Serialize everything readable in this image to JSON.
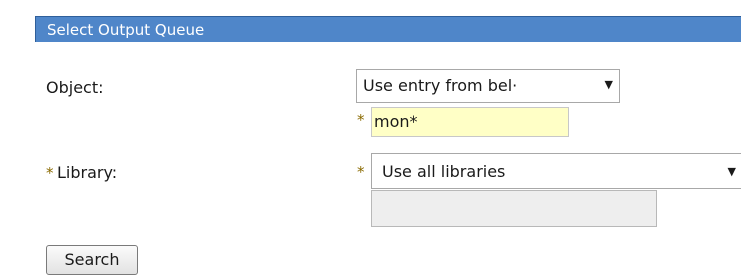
{
  "panel": {
    "title": "Select Output Queue"
  },
  "object": {
    "label": "Object:",
    "select_value": "Use entry from bel·",
    "required_marker": "*",
    "input_value": "mon*"
  },
  "library": {
    "required_marker": "*",
    "label": "Library:",
    "field_required_marker": "*",
    "select_value": "Use all libraries",
    "input_value": ""
  },
  "search_button": {
    "label": "Search"
  },
  "icons": {
    "dropdown_arrow": "▼"
  },
  "colors": {
    "header_bg": "#4f86c9",
    "required": "#8a6a00",
    "input_highlight": "#ffffc6",
    "input_disabled": "#eeeeee"
  }
}
